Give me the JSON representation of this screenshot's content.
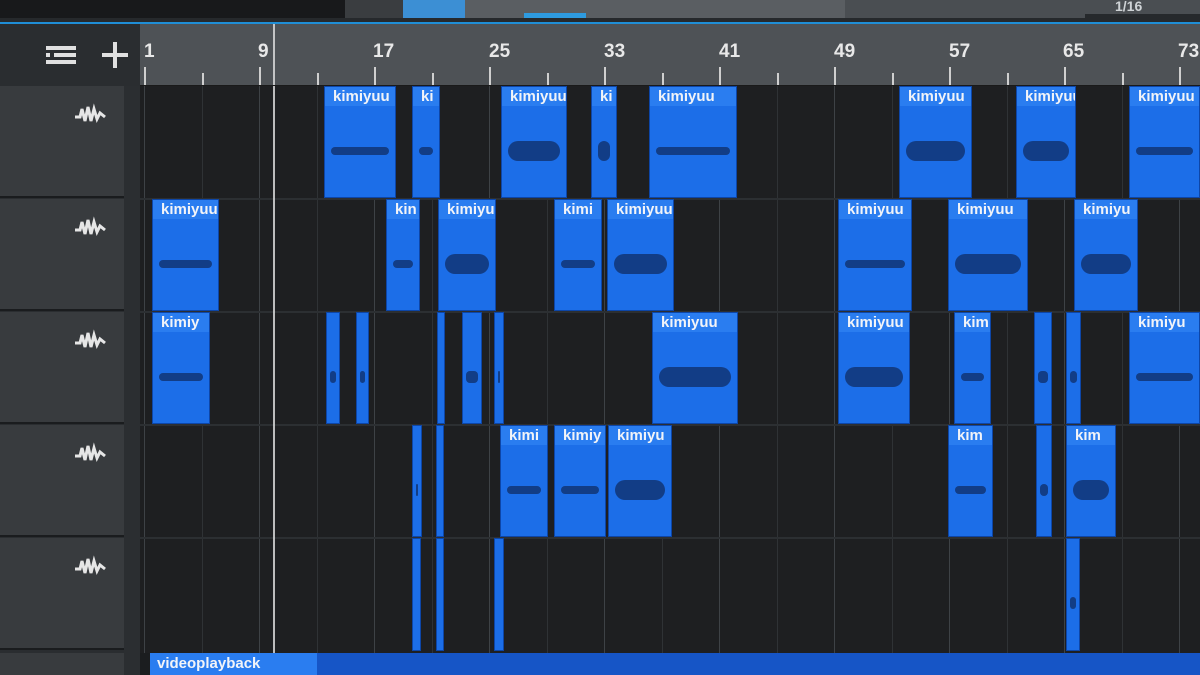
{
  "top_bar": {
    "readout_text": "1/16"
  },
  "track_header": {
    "list_button_label": "Track List",
    "add_button_label": "Add Track"
  },
  "ruler": {
    "bar_labels": [
      "1",
      "9",
      "17",
      "25",
      "33",
      "41",
      "49",
      "57",
      "65",
      "73"
    ]
  },
  "tracks": [
    {
      "icon": "waveform-icon"
    },
    {
      "icon": "waveform-icon"
    },
    {
      "icon": "waveform-icon"
    },
    {
      "icon": "waveform-icon"
    },
    {
      "icon": "waveform-icon"
    }
  ],
  "events": {
    "track1": [
      "kimiyuu",
      "ki",
      "kimiyuu",
      "ki",
      "kimiyuu",
      "kimiyuu",
      "kimiyuu",
      "kimiyuu"
    ],
    "track2": [
      "kimiyuu",
      "kin",
      "kimiyu",
      "kimi",
      "kimiyuu",
      "kimiyuu",
      "kimiyuu",
      "kimiyu"
    ],
    "track3": [
      "kimiy",
      "kimiyuu",
      "kimiyuu",
      "kim",
      "kimiyu"
    ],
    "track4": [
      "kimi",
      "kimiy",
      "kimiyu",
      "kim",
      "kim"
    ]
  },
  "video_track": {
    "event_label": "videoplayback"
  },
  "colors": {
    "event_fill": "#1c6ee8",
    "event_title": "#2a7df0",
    "ruler_bg": "#4e5256",
    "accent": "#2e9be0"
  }
}
